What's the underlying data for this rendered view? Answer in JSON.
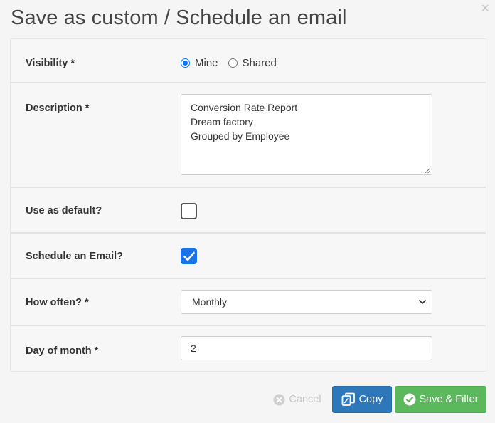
{
  "dialog": {
    "title": "Save as custom / Schedule an email",
    "close_glyph": "×"
  },
  "form": {
    "visibility": {
      "label": "Visibility *",
      "options": [
        {
          "label": "Mine",
          "checked": true
        },
        {
          "label": "Shared",
          "checked": false
        }
      ]
    },
    "description": {
      "label": "Description *",
      "lines": [
        "Conversion Rate Report",
        "Dream factory",
        "Grouped by Employee"
      ]
    },
    "use_as_default": {
      "label": "Use as default?",
      "checked": false
    },
    "schedule_email": {
      "label": "Schedule an Email?",
      "checked": true
    },
    "how_often": {
      "label": "How often? *",
      "selected": "Monthly"
    },
    "day_of_month": {
      "label": "Day of month *",
      "value": "2"
    }
  },
  "footer": {
    "cancel_label": "Cancel",
    "copy_label": "Copy",
    "save_label": "Save & Filter"
  },
  "colors": {
    "accent_blue": "#1a73e8",
    "copy_button": "#2e77b9",
    "save_button": "#5cb85c",
    "disabled_text": "#c4c4c4"
  },
  "icons": {
    "close": "close-icon",
    "cancel": "x-circle-icon",
    "copy": "copy-icon",
    "save": "check-circle-icon",
    "select": "chevron-down-icon"
  }
}
